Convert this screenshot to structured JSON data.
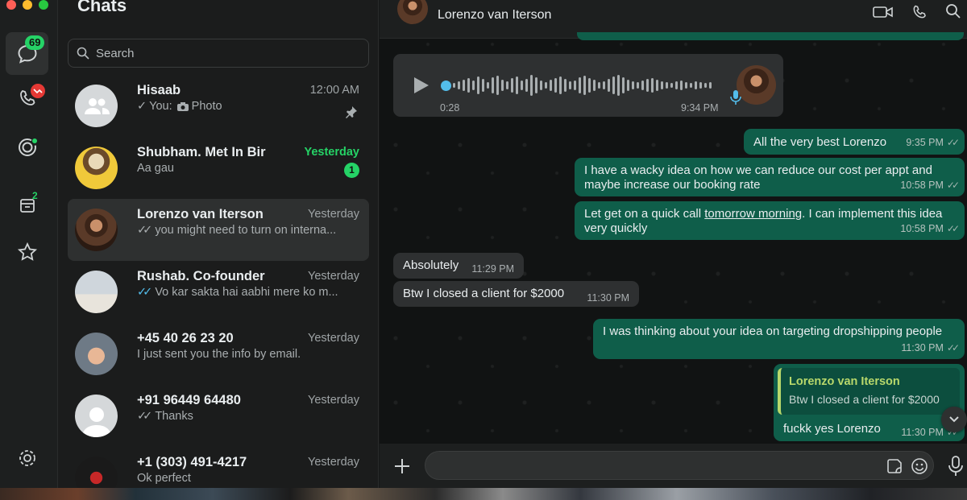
{
  "rail": {
    "chats_badge": "69",
    "archived_badge": "2"
  },
  "chatlist": {
    "title": "Chats",
    "search_placeholder": "Search",
    "items": [
      {
        "name": "Hisaab",
        "time": "12:00 AM",
        "sender": "You:",
        "preview": "Photo"
      },
      {
        "name": "Shubham. Met In Bir",
        "time": "Yesterday",
        "preview": "Aa gau",
        "unread": "1"
      },
      {
        "name": "Lorenzo van Iterson",
        "time": "Yesterday",
        "preview": "you might need to turn on interna..."
      },
      {
        "name": "Rushab. Co-founder",
        "time": "Yesterday",
        "preview": "Vo kar sakta hai aabhi mere ko m..."
      },
      {
        "name": "+45 40 26 23 20",
        "time": "Yesterday",
        "preview": "I just sent you the info by email."
      },
      {
        "name": "+91 96449 64480",
        "time": "Yesterday",
        "preview": "Thanks"
      },
      {
        "name": "+1 (303) 491-4217",
        "time": "Yesterday",
        "preview": "Ok perfect"
      }
    ]
  },
  "conversation": {
    "contact_name": "Lorenzo van Iterson",
    "voice_note": {
      "duration": "0:28",
      "time": "9:34 PM"
    },
    "messages": [
      {
        "text": "All the very best Lorenzo",
        "time": "9:35 PM"
      },
      {
        "text": "I have a wacky idea on how we can reduce our cost per appt and maybe increase our booking rate",
        "time": "10:58 PM"
      },
      {
        "text_before": "Let get on a quick call ",
        "link": "tomorrow morning",
        "text_after": ". I can implement this idea very quickly",
        "time": "10:58 PM"
      },
      {
        "text": "Absolutely",
        "time": "11:29 PM"
      },
      {
        "text": "Btw I closed a client for $2000",
        "time": "11:30 PM"
      },
      {
        "text": "I was thinking about your idea on targeting dropshipping people",
        "time": "11:30 PM"
      },
      {
        "quote_author": "Lorenzo van Iterson",
        "quote_text": "Btw I closed a client for $2000",
        "text": "fuckk yes Lorenzo",
        "time": "11:30 PM"
      }
    ]
  },
  "colors": {
    "accent": "#25d366",
    "outgoing": "#0f5e4a",
    "incoming": "#2e3031"
  },
  "composer": {
    "placeholder": ""
  }
}
